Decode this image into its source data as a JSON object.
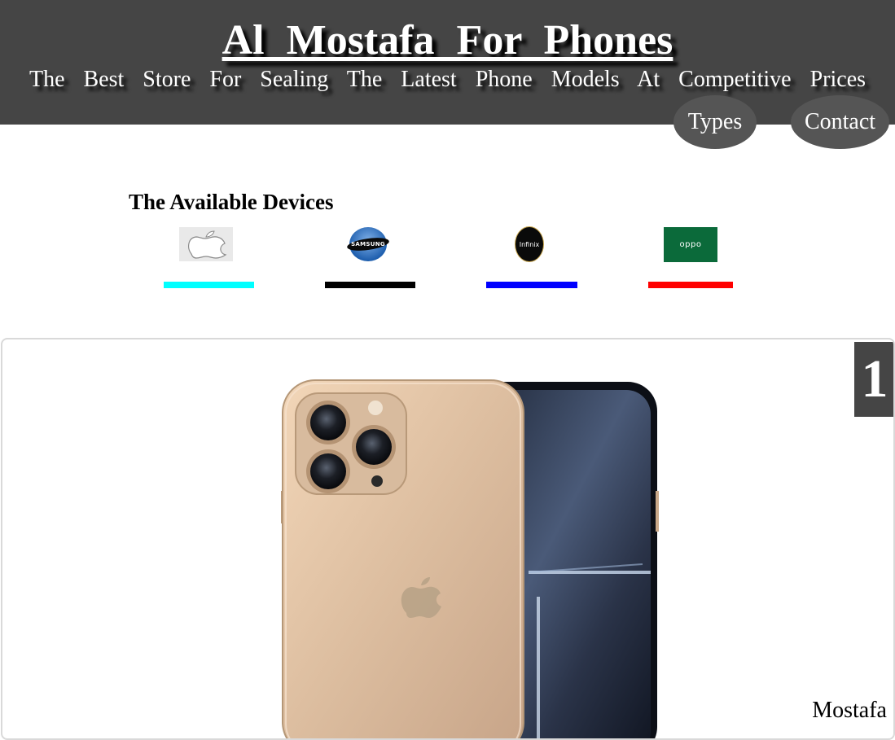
{
  "header": {
    "title": "Al Mostafa For Phones",
    "tagline": "The Best Store For Sealing The Latest Phone Models At Competitive Prices",
    "nav": [
      {
        "label": "Types"
      },
      {
        "label": "Contact"
      }
    ],
    "background_color": "#454545",
    "nav_button_color": "#555555"
  },
  "devices": {
    "heading": "The Available Devices",
    "brands": [
      {
        "name": "Apple",
        "icon": "apple-logo",
        "bar_color": "#00ffff"
      },
      {
        "name": "Samsung",
        "icon": "samsung-logo",
        "logo_text": "SAMSUNG",
        "bar_color": "#000000"
      },
      {
        "name": "Infinix",
        "icon": "infinix-logo",
        "logo_text": "Infinix",
        "bar_color": "#0000ff"
      },
      {
        "name": "OPPO",
        "icon": "oppo-logo",
        "logo_text": "oppo",
        "bar_color": "#ff0000"
      }
    ]
  },
  "slideshow": {
    "number": "1",
    "caption": "Mostafa",
    "image": "iphone-gold-rear-and-front"
  }
}
